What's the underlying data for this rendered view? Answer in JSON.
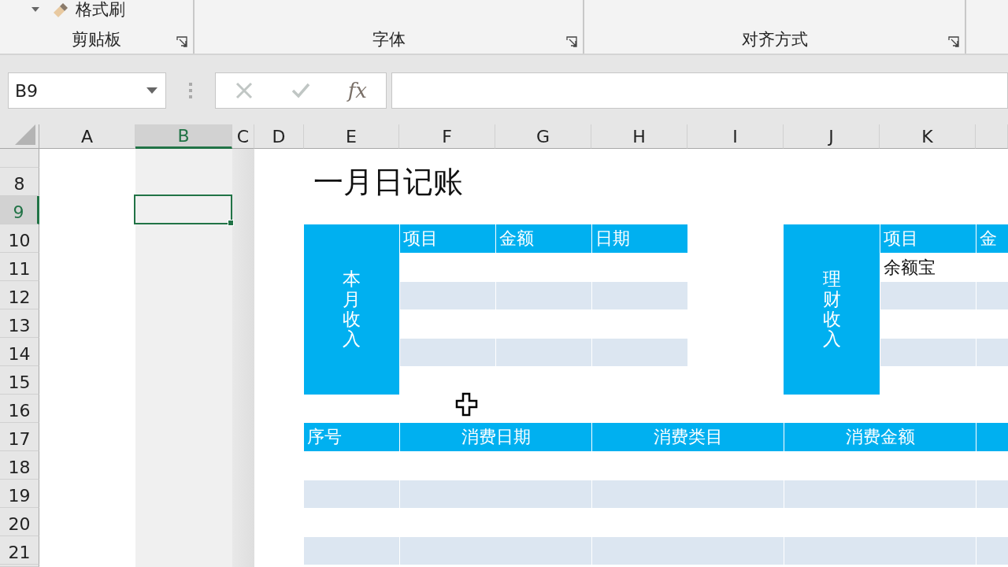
{
  "ribbon": {
    "clipped_button": {
      "label": "格式刷"
    },
    "groups": [
      {
        "label": "剪贴板"
      },
      {
        "label": "字体"
      },
      {
        "label": "对齐方式"
      }
    ]
  },
  "formula_bar": {
    "name_box": "B9",
    "function_label": "fx"
  },
  "columns": [
    {
      "label": "A",
      "selected": false
    },
    {
      "label": "B",
      "selected": true
    },
    {
      "label": "C",
      "selected": false
    },
    {
      "label": "D",
      "selected": false
    },
    {
      "label": "E",
      "selected": false
    },
    {
      "label": "F",
      "selected": false
    },
    {
      "label": "G",
      "selected": false
    },
    {
      "label": "H",
      "selected": false
    },
    {
      "label": "I",
      "selected": false
    },
    {
      "label": "J",
      "selected": false
    },
    {
      "label": "K",
      "selected": false
    }
  ],
  "rows": [
    {
      "label": "8",
      "selected": false
    },
    {
      "label": "9",
      "selected": true
    },
    {
      "label": "10",
      "selected": false
    },
    {
      "label": "11",
      "selected": false
    },
    {
      "label": "12",
      "selected": false
    },
    {
      "label": "13",
      "selected": false
    },
    {
      "label": "14",
      "selected": false
    },
    {
      "label": "15",
      "selected": false
    },
    {
      "label": "16",
      "selected": false
    },
    {
      "label": "17",
      "selected": false
    },
    {
      "label": "18",
      "selected": false
    },
    {
      "label": "19",
      "selected": false
    },
    {
      "label": "20",
      "selected": false
    },
    {
      "label": "21",
      "selected": false
    }
  ],
  "title": "一月日记账",
  "income_tables": [
    {
      "label": "本月收入",
      "columns": [
        "项目",
        "金额",
        "日期"
      ],
      "rows": [
        [
          null,
          null,
          null
        ],
        [
          null,
          null,
          null
        ],
        [
          null,
          null,
          null
        ],
        [
          null,
          null,
          null
        ]
      ]
    },
    {
      "label": "理财收入",
      "columns": [
        "项目",
        "金"
      ],
      "rows": [
        [
          "余额宝",
          null
        ],
        [
          null,
          null
        ],
        [
          null,
          null
        ],
        [
          null,
          null
        ]
      ]
    }
  ],
  "expense_table": {
    "columns": [
      "序号",
      "消费日期",
      "消费类目",
      "消费金额"
    ],
    "rows": [
      [
        null,
        null,
        null,
        null
      ],
      [
        null,
        null,
        null,
        null
      ],
      [
        null,
        null,
        null,
        null
      ],
      [
        null,
        null,
        null,
        null
      ]
    ]
  }
}
